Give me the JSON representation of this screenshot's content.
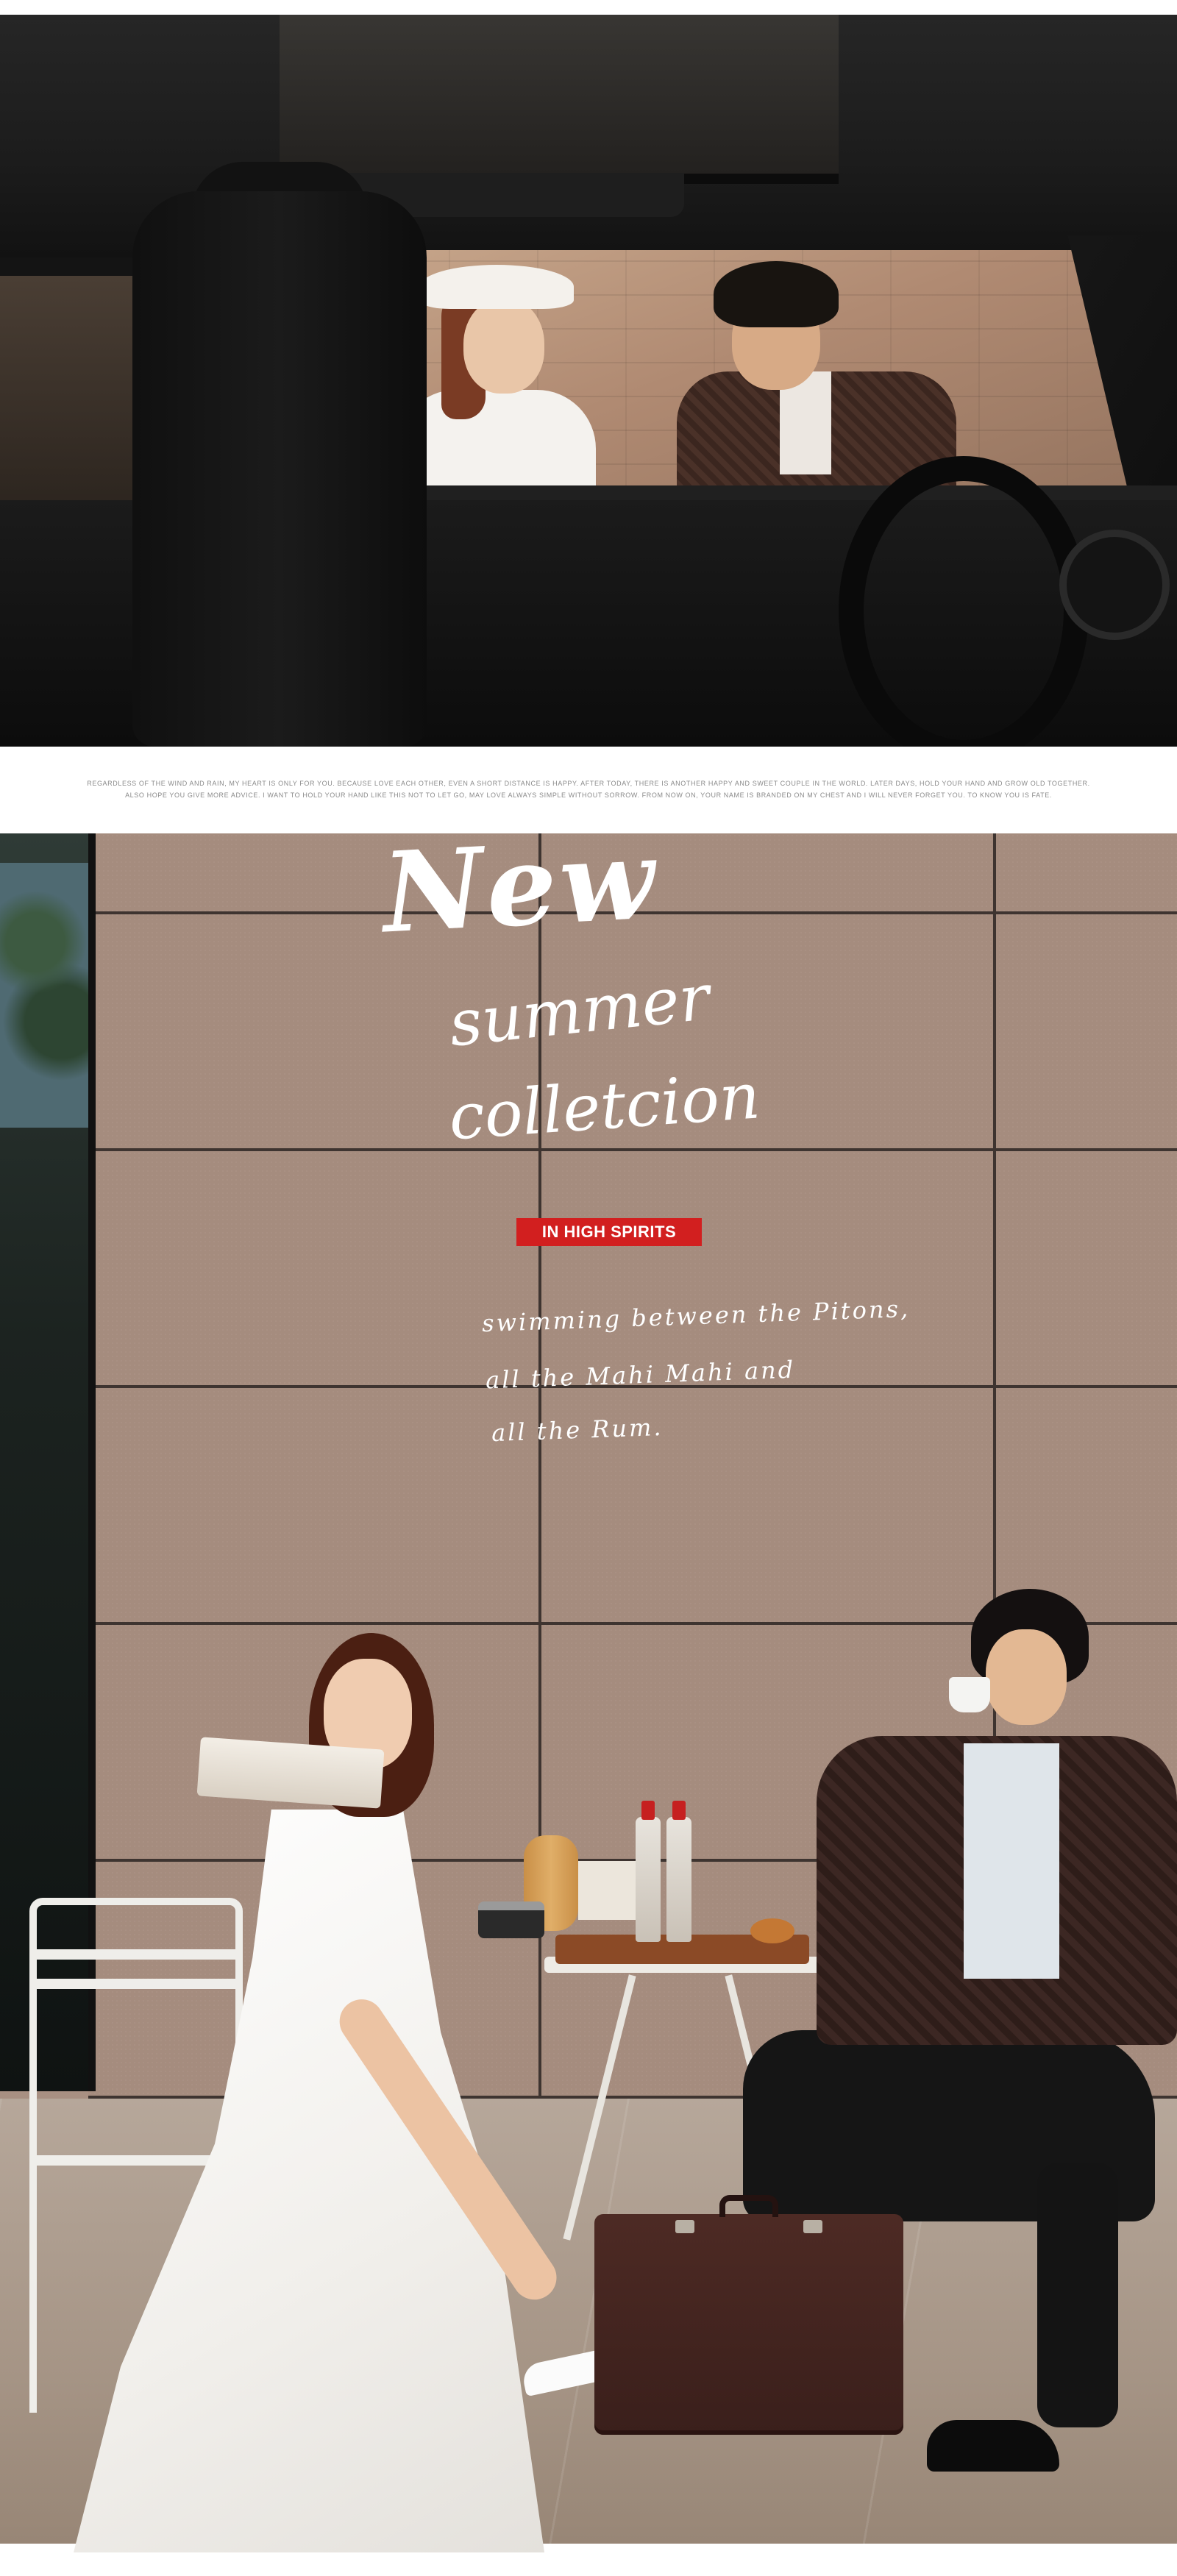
{
  "blurb": {
    "line1": "Regardless of the wind and rain, my heart is only for you. Because love each other, even a short distance is happy. After today, there is another happy and sweet couple in the world. Later days, hold your hand and grow old together.",
    "line2": "Also hope you give more advice. I want to hold your hand like this not to let go, may love always simple without sorrow. From now on, your name is branded on my chest and I will never forget you. To know you is fate."
  },
  "poster": {
    "title_new": "New",
    "title_summer": "summer",
    "title_collection": "colletcion",
    "badge": "IN HIGH SPIRITS",
    "script": [
      "swimming between the Pitons,",
      "all the Mahi Mahi and",
      "all the Rum."
    ]
  },
  "colors": {
    "badge_bg": "#d21f1f",
    "script_text": "#ffffff",
    "page_bg": "#ffffff"
  }
}
